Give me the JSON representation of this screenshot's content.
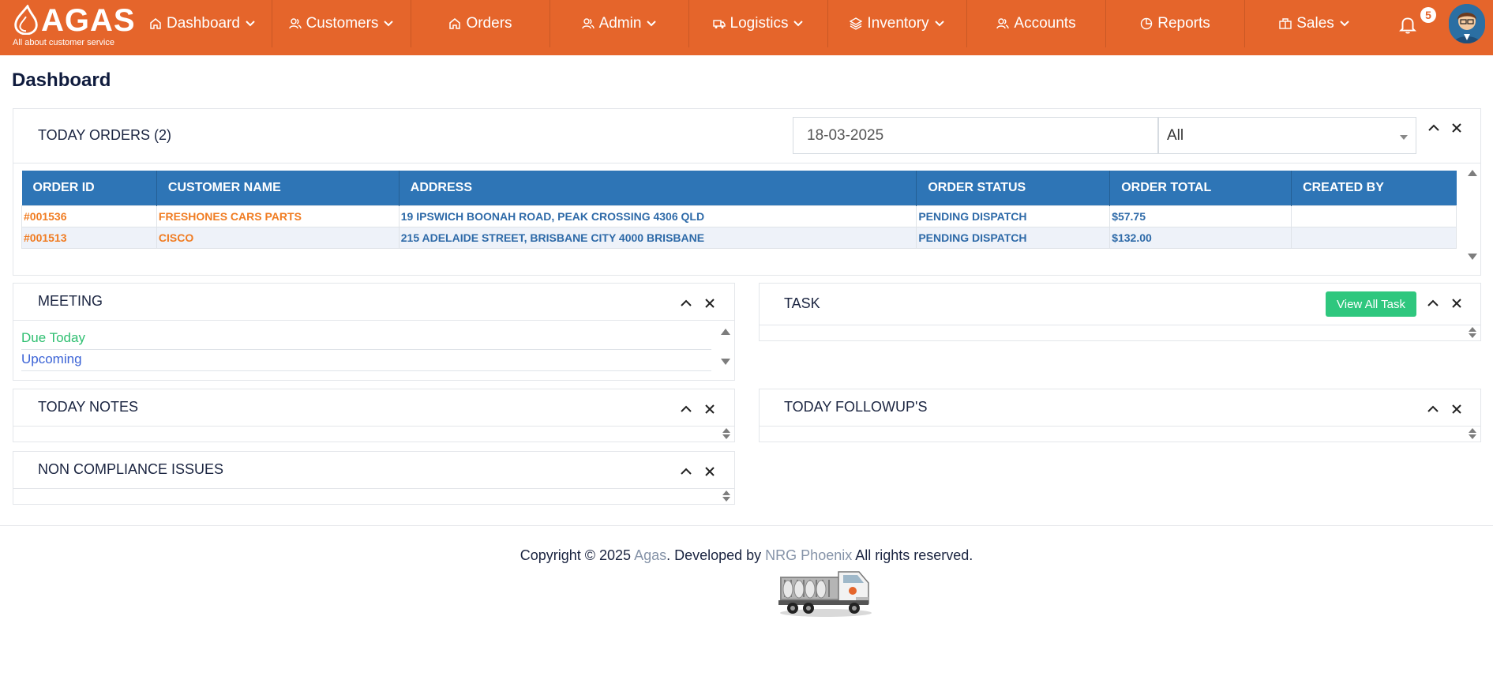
{
  "brand": {
    "name": "AGAS",
    "tagline": "All about customer service"
  },
  "nav": {
    "items": [
      {
        "label": "Dashboard",
        "icon": "home-icon",
        "dropdown": true
      },
      {
        "label": "Customers",
        "icon": "users-icon",
        "dropdown": true
      },
      {
        "label": "Orders",
        "icon": "home-icon",
        "dropdown": false
      },
      {
        "label": "Admin",
        "icon": "users-icon",
        "dropdown": true
      },
      {
        "label": "Logistics",
        "icon": "truck-icon",
        "dropdown": true
      },
      {
        "label": "Inventory",
        "icon": "layers-icon",
        "dropdown": true
      },
      {
        "label": "Accounts",
        "icon": "users-icon",
        "dropdown": false
      },
      {
        "label": "Reports",
        "icon": "pie-chart-icon",
        "dropdown": false
      },
      {
        "label": "Sales",
        "icon": "briefcase-icon",
        "dropdown": true
      }
    ],
    "notification_count": "5"
  },
  "page": {
    "title": "Dashboard"
  },
  "orders_panel": {
    "title": "TODAY ORDERS (2)",
    "date_value": "18-03-2025",
    "filter_value": "All",
    "columns": [
      "ORDER ID",
      "CUSTOMER NAME",
      "ADDRESS",
      "ORDER STATUS",
      "ORDER TOTAL",
      "CREATED BY"
    ],
    "rows": [
      {
        "order_id": "#001536",
        "customer": "FRESHONES CARS PARTS",
        "address": "19 IPSWICH BOONAH ROAD, PEAK CROSSING 4306 QLD",
        "status": "PENDING DISPATCH",
        "total": "$57.75",
        "created_by": ""
      },
      {
        "order_id": "#001513",
        "customer": "CISCO",
        "address": "215 ADELAIDE STREET, BRISBANE CITY 4000 BRISBANE",
        "status": "PENDING DISPATCH",
        "total": "$132.00",
        "created_by": ""
      }
    ]
  },
  "meeting_panel": {
    "title": "MEETING",
    "due_today": "Due Today",
    "upcoming": "Upcoming"
  },
  "task_panel": {
    "title": "TASK",
    "view_all": "View All Task"
  },
  "notes_panel": {
    "title": "TODAY NOTES"
  },
  "followup_panel": {
    "title": "TODAY FOLLOWUP'S"
  },
  "compliance_panel": {
    "title": "NON COMPLIANCE ISSUES"
  },
  "footer": {
    "prefix": "Copyright © 2025 ",
    "brand": "Agas",
    "middle": ". Developed by ",
    "developer": "NRG Phoenix",
    "suffix": " All rights reserved."
  },
  "colors": {
    "nav_bg": "#e5652b",
    "table_header": "#2e75b6",
    "accent_orange": "#f07c22",
    "accent_green": "#2fc77e",
    "link_blue": "#3b63d6"
  }
}
